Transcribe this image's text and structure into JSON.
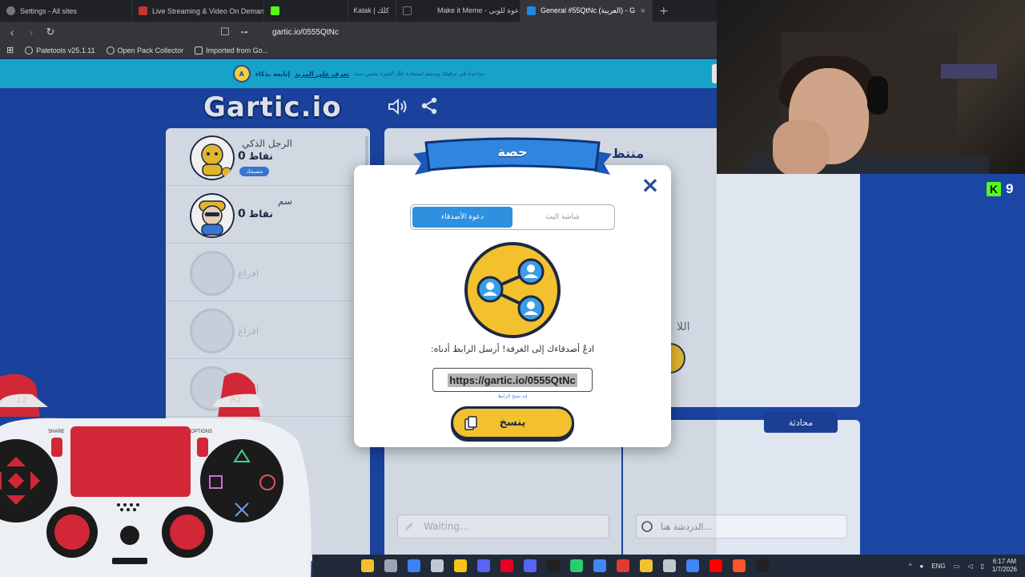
{
  "browser": {
    "tabs": [
      {
        "label": "Settings - All sites",
        "favicon_color": "#8a8a8a",
        "active": false
      },
      {
        "label": "Live Streaming & Video On Demand",
        "favicon_color": "#c0392b",
        "active": false
      },
      {
        "label": "",
        "favicon_color": "#53fc18",
        "active": false
      },
      {
        "label": "Kalak | كلك",
        "favicon_color": "#202124",
        "active": false
      },
      {
        "label": "Make it Meme - دعوة للوبي",
        "favicon_color": "#ffffff",
        "active": false
      },
      {
        "label": "General #55QtNc (العربية) - Gartic",
        "favicon_color": "#1e88e5",
        "active": true
      }
    ],
    "new_tab": "+",
    "url": "gartic.io/0555QtNc",
    "bookmarks": [
      "Paletools v25.1.11",
      "Open Pack Collector",
      "Imported from Go..."
    ]
  },
  "banner": {
    "badge": "A",
    "text": "إتابعة بذكاء",
    "link": "تعرف على المزيد",
    "small": "ساعدنا في ترقيتك وستتم استعادة تلك الفترة بنفس سنة"
  },
  "game": {
    "logo": "Gartic.io",
    "players": [
      {
        "name": "الرجل الذكي",
        "points": "0",
        "points_label": "نقاط",
        "you_badge": "مضيفك"
      },
      {
        "name": "سم",
        "points": "0",
        "points_label": "نقاط",
        "you_badge": ""
      },
      {
        "name": "افراغ",
        "empty": true
      },
      {
        "name": "افراغ",
        "empty": true
      },
      {
        "name": "افراغ",
        "empty": true
      }
    ],
    "canvas_word": "منتظ",
    "canvas_label": "اللا",
    "chat_tab": "محادثة",
    "answers_placeholder": "Waiting...",
    "chat_placeholder": "الدردشة هنا..."
  },
  "modal": {
    "title": "حصة",
    "close": "×",
    "segments": [
      {
        "label": "دعوة الأصدقاء",
        "active": true
      },
      {
        "label": "شاشة البث",
        "active": false
      }
    ],
    "invite_text": "ادعُ أصدقاءك إلى الغرفة! أرسل الرابط أدناه:",
    "link": "https://gartic.io/0555QtNc",
    "copy_hint": "إنه نسخ الرابط",
    "copy_button": "ينسخ"
  },
  "controller": {
    "share_label": "SHARE",
    "options_label": "OPTIONS",
    "l2": "L2",
    "r2": "R2"
  },
  "stream": {
    "kick_logo": "K",
    "viewers": "9"
  },
  "taskbar": {
    "lang": "ENG",
    "time": "6:17 AM",
    "date": "1/7/2026",
    "icon_colors": [
      "#f4c12e",
      "#9aa4b2",
      "#3b82f6",
      "#c2c8d0",
      "#f5c518",
      "#5865f2",
      "#e60023",
      "#5865f2",
      "#222",
      "#2ecc71",
      "#4285f4",
      "#e53935",
      "#f4c12e",
      "#c2c8d0",
      "#4285f4",
      "#ff0000",
      "#fb542b",
      "#222"
    ]
  }
}
